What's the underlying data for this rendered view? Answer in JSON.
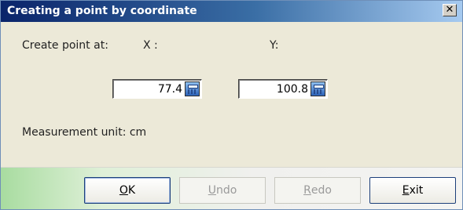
{
  "dialog": {
    "title": "Creating a point by coordinate",
    "close_glyph": "✕",
    "create_point_label": "Create point at:",
    "x_label": "X :",
    "y_label": "Y:",
    "x_field": {
      "value": "77.4",
      "icon": "calculator-icon"
    },
    "y_field": {
      "value": "100.8",
      "icon": "calculator-icon"
    },
    "measurement_unit_label": "Measurement unit: cm"
  },
  "buttons": {
    "ok": {
      "mnemonic": "O",
      "rest": "K",
      "enabled": true
    },
    "undo": {
      "mnemonic": "U",
      "rest": "ndo",
      "enabled": false
    },
    "redo": {
      "mnemonic": "R",
      "rest": "edo",
      "enabled": false
    },
    "exit": {
      "mnemonic": "E",
      "rest": "xit",
      "enabled": true
    }
  }
}
